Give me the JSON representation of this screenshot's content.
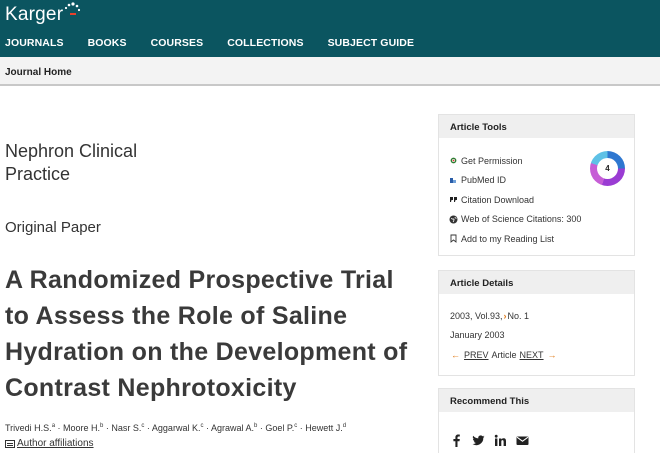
{
  "header": {
    "logo_text": "Karger",
    "nav": [
      "JOURNALS",
      "BOOKS",
      "COURSES",
      "COLLECTIONS",
      "SUBJECT GUIDE"
    ],
    "brand_color": "#0b5560"
  },
  "subnav": {
    "journal_home": "Journal Home"
  },
  "article": {
    "journal_line1": "Nephron Clinical",
    "journal_line2": "Practice",
    "type": "Original Paper",
    "title": "A Randomized Prospective Trial to Assess the Role of Saline Hydration on the Development of Contrast Nephrotoxicity",
    "authors": [
      {
        "name": "Trivedi H.S.",
        "sup": "a"
      },
      {
        "name": "Moore H.",
        "sup": "b"
      },
      {
        "name": "Nasr S.",
        "sup": "c"
      },
      {
        "name": "Aggarwal K.",
        "sup": "c"
      },
      {
        "name": "Agrawal A.",
        "sup": "b"
      },
      {
        "name": "Goel P.",
        "sup": "c"
      },
      {
        "name": "Hewett J.",
        "sup": "d"
      }
    ],
    "affiliations_label": "Author affiliations"
  },
  "tools": {
    "header": "Article Tools",
    "items": [
      {
        "label": "Get Permission",
        "icon": "permission-icon"
      },
      {
        "label": "PubMed ID",
        "icon": "pubmed-icon"
      },
      {
        "label": "Citation Download",
        "icon": "quote-icon"
      },
      {
        "label": "Web of Science Citations: 300",
        "icon": "globe-icon"
      },
      {
        "label": "Add to my Reading List",
        "icon": "bookmark-icon"
      }
    ],
    "altmetric_score": "4"
  },
  "details": {
    "header": "Article Details",
    "year_vol": "2003, Vol.93,",
    "issue": "No. 1",
    "date": "January 2003",
    "prev": "PREV",
    "article": "Article",
    "next": "NEXT",
    "accent": "#e07a18"
  },
  "recommend": {
    "header": "Recommend This",
    "icons": [
      "facebook-icon",
      "twitter-icon",
      "linkedin-icon",
      "email-icon"
    ]
  }
}
